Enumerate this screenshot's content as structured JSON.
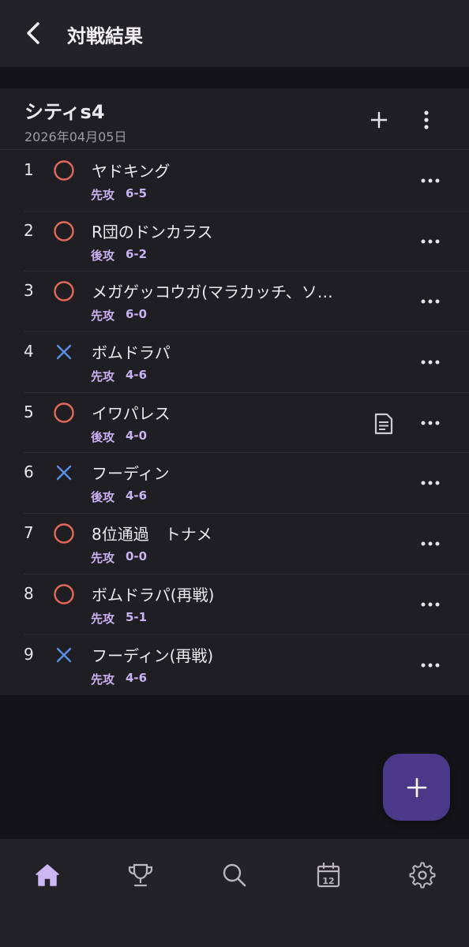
{
  "appbar": {
    "title": "対戦結果",
    "back_icon": "back-arrow-icon"
  },
  "event": {
    "name": "シティs4",
    "date": "2026年04月05日"
  },
  "colors": {
    "win": "#e0695a",
    "loss": "#5b8ee8",
    "accent": "#c9b2f2",
    "fab": "#4a3889",
    "nav_active": "#cdb7f5"
  },
  "matches": [
    {
      "no": "1",
      "result": "win",
      "opponent": "ヤドキング",
      "order": "先攻",
      "score": "6-5",
      "memo": false
    },
    {
      "no": "2",
      "result": "win",
      "opponent": "R団のドンカラス",
      "order": "後攻",
      "score": "6-2",
      "memo": false
    },
    {
      "no": "3",
      "result": "win",
      "opponent": "メガゲッコウガ(マラカッチ、ソ…",
      "order": "先攻",
      "score": "6-0",
      "memo": false
    },
    {
      "no": "4",
      "result": "loss",
      "opponent": "ボムドラパ",
      "order": "先攻",
      "score": "4-6",
      "memo": false
    },
    {
      "no": "5",
      "result": "win",
      "opponent": "イワパレス",
      "order": "後攻",
      "score": "4-0",
      "memo": true
    },
    {
      "no": "6",
      "result": "loss",
      "opponent": "フーディン",
      "order": "後攻",
      "score": "4-6",
      "memo": false
    },
    {
      "no": "7",
      "result": "win",
      "opponent": "8位通過　トナメ",
      "order": "先攻",
      "score": "0-0",
      "memo": false
    },
    {
      "no": "8",
      "result": "win",
      "opponent": "ボムドラパ(再戦)",
      "order": "先攻",
      "score": "5-1",
      "memo": false
    },
    {
      "no": "9",
      "result": "loss",
      "opponent": "フーディン(再戦)",
      "order": "先攻",
      "score": "4-6",
      "memo": false
    }
  ],
  "bottom_nav": [
    {
      "icon": "home-icon",
      "active": true
    },
    {
      "icon": "trophy-icon",
      "active": false
    },
    {
      "icon": "search-icon",
      "active": false
    },
    {
      "icon": "calendar-icon",
      "active": false,
      "label": "12"
    },
    {
      "icon": "settings-icon",
      "active": false
    }
  ]
}
